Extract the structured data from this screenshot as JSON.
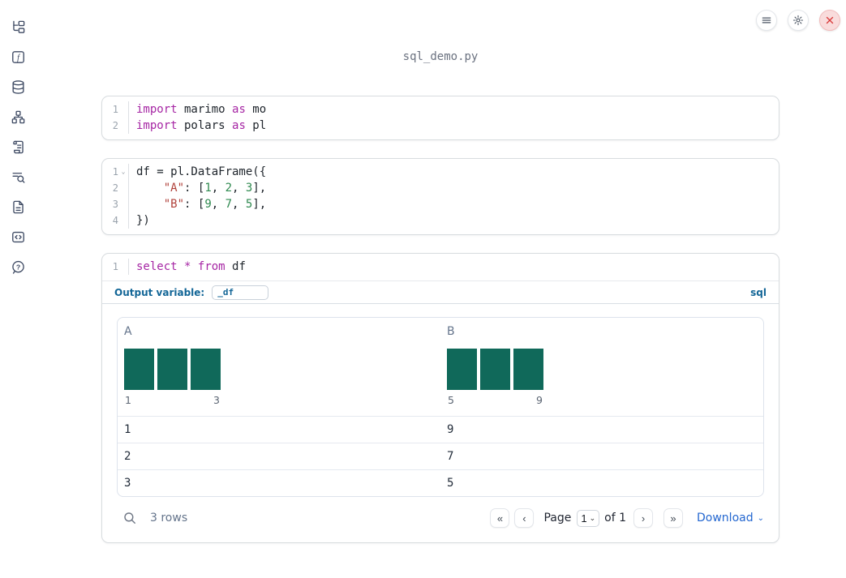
{
  "app": {
    "title": "sql_demo.py"
  },
  "topbar": {
    "buttons": [
      {
        "name": "menu",
        "icon": "hamburger-icon"
      },
      {
        "name": "settings",
        "icon": "gear-icon"
      },
      {
        "name": "shutdown",
        "icon": "close-icon"
      }
    ]
  },
  "sidebar": {
    "items": [
      {
        "icon": "file-tree-icon"
      },
      {
        "icon": "function-icon"
      },
      {
        "icon": "database-icon"
      },
      {
        "icon": "dependency-graph-icon"
      },
      {
        "icon": "scroll-icon"
      },
      {
        "icon": "logs-search-icon"
      },
      {
        "icon": "document-icon"
      },
      {
        "icon": "code-snippets-icon"
      },
      {
        "icon": "help-icon"
      }
    ]
  },
  "cells": [
    {
      "kind": "python",
      "lines": [
        {
          "no": "1",
          "tokens": [
            {
              "c": "kw",
              "t": "import"
            },
            {
              "c": "pl",
              "t": " marimo "
            },
            {
              "c": "kw",
              "t": "as"
            },
            {
              "c": "pl",
              "t": " mo"
            }
          ]
        },
        {
          "no": "2",
          "tokens": [
            {
              "c": "kw",
              "t": "import"
            },
            {
              "c": "pl",
              "t": " polars "
            },
            {
              "c": "kw",
              "t": "as"
            },
            {
              "c": "pl",
              "t": " pl"
            }
          ]
        }
      ]
    },
    {
      "kind": "python",
      "lines": [
        {
          "no": "1",
          "fold": true,
          "tokens": [
            {
              "c": "pl",
              "t": "df = pl.DataFrame({"
            }
          ]
        },
        {
          "no": "2",
          "tokens": [
            {
              "c": "pl",
              "t": "    "
            },
            {
              "c": "str",
              "t": "\"A\""
            },
            {
              "c": "pl",
              "t": ": ["
            },
            {
              "c": "num",
              "t": "1"
            },
            {
              "c": "pl",
              "t": ", "
            },
            {
              "c": "num",
              "t": "2"
            },
            {
              "c": "pl",
              "t": ", "
            },
            {
              "c": "num",
              "t": "3"
            },
            {
              "c": "pl",
              "t": "],"
            }
          ]
        },
        {
          "no": "3",
          "tokens": [
            {
              "c": "pl",
              "t": "    "
            },
            {
              "c": "str",
              "t": "\"B\""
            },
            {
              "c": "pl",
              "t": ": ["
            },
            {
              "c": "num",
              "t": "9"
            },
            {
              "c": "pl",
              "t": ", "
            },
            {
              "c": "num",
              "t": "7"
            },
            {
              "c": "pl",
              "t": ", "
            },
            {
              "c": "num",
              "t": "5"
            },
            {
              "c": "pl",
              "t": "],"
            }
          ]
        },
        {
          "no": "4",
          "tokens": [
            {
              "c": "pl",
              "t": "})"
            }
          ]
        }
      ]
    },
    {
      "kind": "sql",
      "lines": [
        {
          "no": "1",
          "tokens": [
            {
              "c": "kw",
              "t": "select"
            },
            {
              "c": "pl",
              "t": " "
            },
            {
              "c": "kw",
              "t": "*"
            },
            {
              "c": "pl",
              "t": " "
            },
            {
              "c": "kw",
              "t": "from"
            },
            {
              "c": "pl",
              "t": " df"
            }
          ]
        }
      ],
      "output_variable_label": "Output variable:",
      "output_variable_value": "_df",
      "language_badge": "sql"
    }
  ],
  "table": {
    "columns": [
      {
        "name": "A",
        "histogram": {
          "bars": [
            1,
            1,
            1
          ],
          "min_label": "1",
          "max_label": "3"
        }
      },
      {
        "name": "B",
        "histogram": {
          "bars": [
            1,
            1,
            1
          ],
          "min_label": "5",
          "max_label": "9"
        }
      }
    ],
    "rows": [
      [
        "1",
        "9"
      ],
      [
        "2",
        "7"
      ],
      [
        "3",
        "5"
      ]
    ],
    "footer": {
      "row_count": "3 rows",
      "page_label": "Page",
      "page_value": "1",
      "of_label": "of 1",
      "download_label": "Download"
    }
  },
  "chart_data": [
    {
      "type": "bar",
      "title": "Column A summary histogram",
      "values": [
        1,
        1,
        1
      ],
      "tick_labels": [
        "1",
        "3"
      ],
      "bar_color": "#10695a"
    },
    {
      "type": "bar",
      "title": "Column B summary histogram",
      "values": [
        1,
        1,
        1
      ],
      "tick_labels": [
        "5",
        "9"
      ],
      "bar_color": "#10695a"
    }
  ],
  "colors": {
    "accent_blue": "#136697",
    "link_blue": "#2467d0",
    "bar_teal": "#10695a",
    "keyword_purple": "#a626a4",
    "string_red": "#b0413a",
    "number_green": "#2f8a50",
    "close_red": "#d93d3d",
    "sidebar_icon": "#3e4a63"
  }
}
